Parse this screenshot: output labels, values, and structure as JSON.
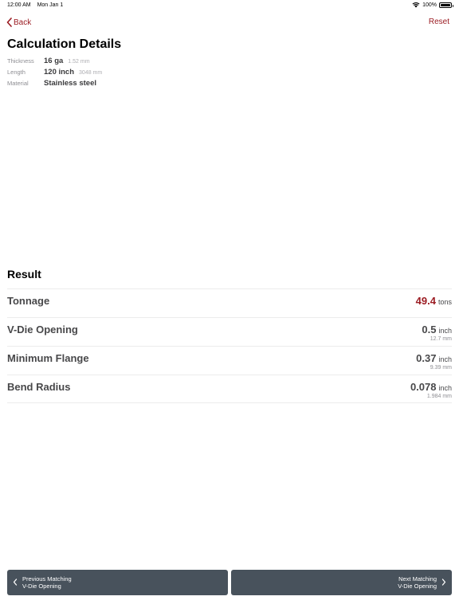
{
  "status_bar": {
    "time": "12:00 AM",
    "date": "Mon Jan 1",
    "battery": "100%",
    "icons": [
      "wifi-icon",
      "battery-icon"
    ]
  },
  "nav": {
    "back_label": "Back",
    "reset_label": "Reset",
    "icons": [
      "chevron-left-icon"
    ]
  },
  "page_title": "Calculation Details",
  "details": [
    {
      "label": "Thickness",
      "value": "16 ga",
      "sub": "1.52 mm"
    },
    {
      "label": "Length",
      "value": "120 inch",
      "sub": "3048 mm"
    },
    {
      "label": "Material",
      "value": "Stainless steel",
      "sub": ""
    }
  ],
  "result_title": "Result",
  "results": [
    {
      "label": "Tonnage",
      "value": "49.4",
      "unit": "tons",
      "sub": ""
    },
    {
      "label": "V-Die Opening",
      "value": "0.5",
      "unit": "inch",
      "sub": "12.7 mm"
    },
    {
      "label": "Minimum Flange",
      "value": "0.37",
      "unit": "inch",
      "sub": "9.39 mm"
    },
    {
      "label": "Bend Radius",
      "value": "0.078",
      "unit": "inch",
      "sub": "1.984 mm"
    }
  ],
  "buttons": {
    "prev_line1": "Previous Matching",
    "prev_line2": "V-Die Opening",
    "next_line1": "Next Matching",
    "next_line2": "V-Die Opening"
  },
  "colors": {
    "accent": "#9b1c23",
    "button_bg": "#48525c",
    "text_dark": "#48484a"
  }
}
